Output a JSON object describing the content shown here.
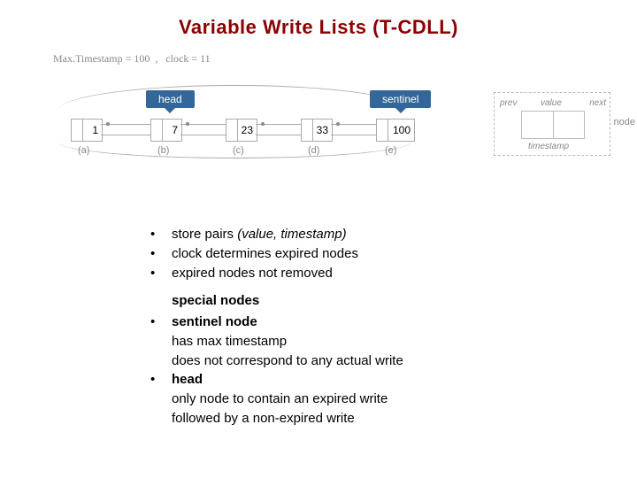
{
  "title": "Variable Write Lists (T-CDLL)",
  "meta": {
    "max_ts_label": "Max.Timestamp",
    "max_ts_value": "100",
    "clock_label": "clock",
    "clock_value": "11"
  },
  "callouts": {
    "head": "head",
    "sentinel": "sentinel"
  },
  "nodes": [
    {
      "value": "1",
      "label": "(a)"
    },
    {
      "value": "7",
      "label": "(b)"
    },
    {
      "value": "23",
      "label": "(c)"
    },
    {
      "value": "33",
      "label": "(d)"
    },
    {
      "value": "100",
      "label": "(e)"
    }
  ],
  "legend": {
    "prev": "prev",
    "value": "value",
    "next": "next",
    "timestamp": "timestamp",
    "node": "node"
  },
  "bullets1": [
    {
      "pre": "store pairs ",
      "ital": "(value, timestamp)",
      "post": ""
    },
    {
      "pre": "clock determines expired nodes",
      "ital": "",
      "post": ""
    },
    {
      "pre": "expired nodes not removed",
      "ital": "",
      "post": ""
    }
  ],
  "subhead": "special nodes",
  "bullets2": [
    {
      "lead_bold": "sentinel node",
      "lines": [
        "has max timestamp",
        "does not correspond to any actual write"
      ]
    },
    {
      "lead_bold": "head",
      "lines": [
        "only node to contain an expired write",
        "followed by a non-expired write"
      ]
    }
  ]
}
